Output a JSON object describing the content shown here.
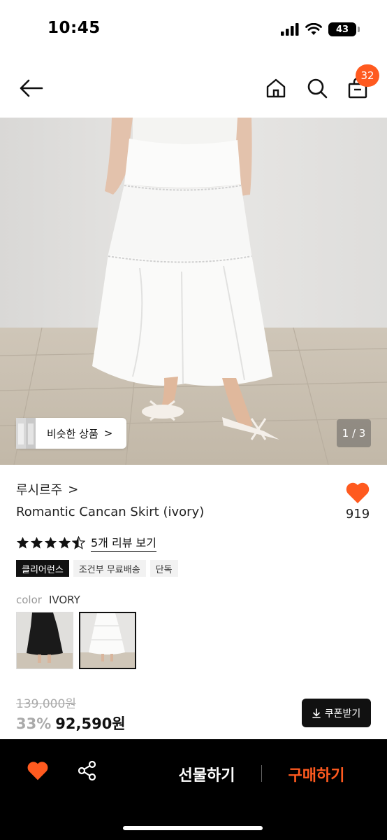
{
  "status_bar": {
    "time": "10:45",
    "battery": "43"
  },
  "header": {
    "cart_count": "32"
  },
  "image": {
    "counter": "1 / 3",
    "similar_label": "비슷한 상품",
    "similar_arrow": ">"
  },
  "product": {
    "brand": "루시르주",
    "brand_arrow": ">",
    "title": "Romantic Cancan Skirt (ivory)",
    "wish_count": "919",
    "rating": 4.5,
    "review_link": "5개 리뷰 보기",
    "tags": [
      "클리어런스",
      "조건부 무료배송",
      "단독"
    ],
    "color_label": "color",
    "color_value": "IVORY",
    "original_price": "139,000원",
    "discount": "33%",
    "sale_price": "92,590원",
    "coupon_label": "쿠폰받기"
  },
  "bottom_bar": {
    "gift_label": "선물하기",
    "buy_label": "구매하기"
  },
  "colors": {
    "accent": "#ff5a1f",
    "dark": "#111111"
  }
}
